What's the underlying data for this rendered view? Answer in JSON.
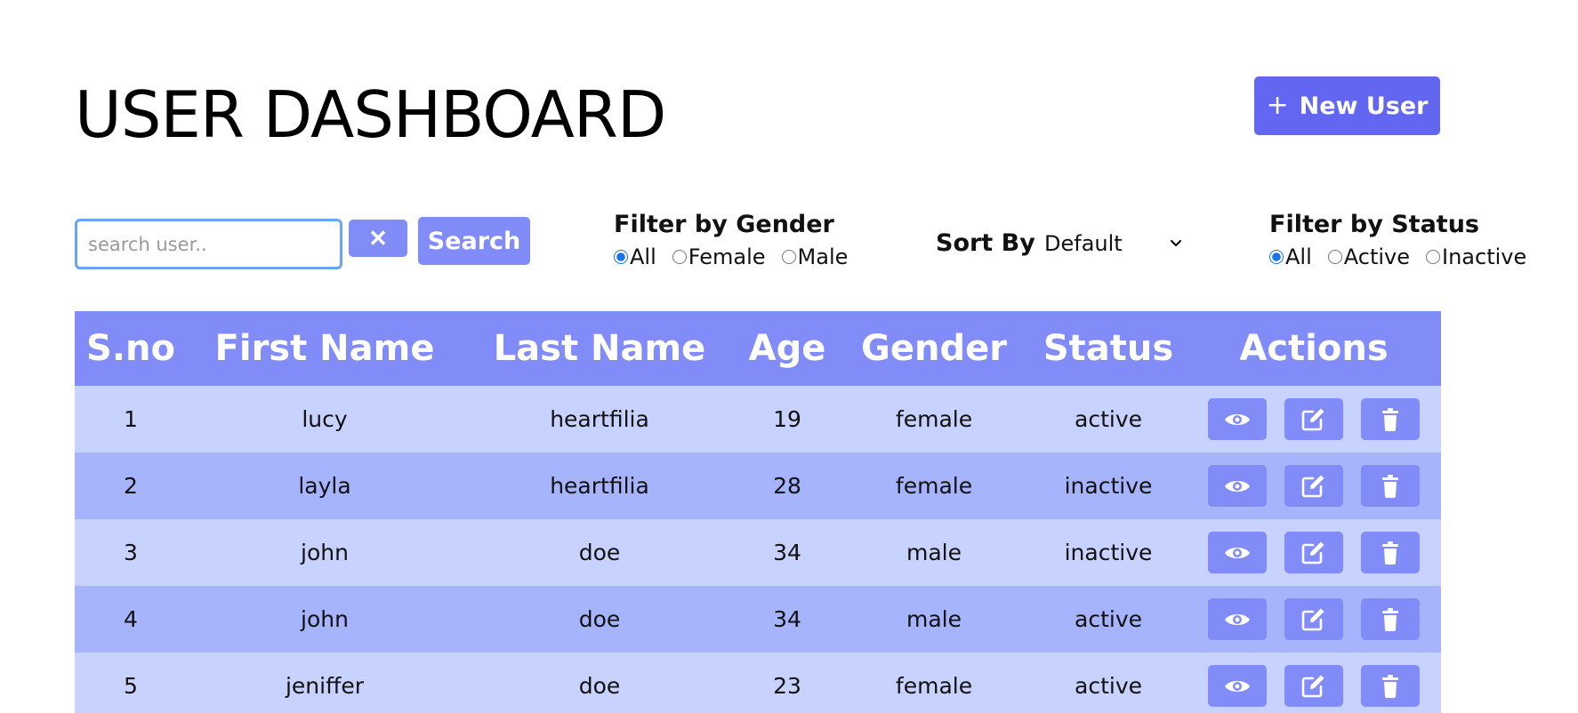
{
  "header": {
    "title": "USER DASHBOARD",
    "new_user_label": "New User",
    "new_user_icon": "plus-icon"
  },
  "toolbar": {
    "search_placeholder": "search user..",
    "search_value": "",
    "clear_label": "✕",
    "search_label": "Search",
    "gender_filter": {
      "title": "Filter by Gender",
      "options": [
        "All",
        "Female",
        "Male"
      ],
      "selected": "All"
    },
    "sort": {
      "label": "Sort By",
      "value": "Default"
    },
    "status_filter": {
      "title": "Filter by Status",
      "options": [
        "All",
        "Active",
        "Inactive"
      ],
      "selected": "All"
    }
  },
  "table": {
    "columns": [
      "S.no",
      "First Name",
      "Last Name",
      "Age",
      "Gender",
      "Status",
      "Actions"
    ],
    "rows": [
      {
        "sno": "1",
        "first": "lucy",
        "last": "heartfilia",
        "age": "19",
        "gender": "female",
        "status": "active"
      },
      {
        "sno": "2",
        "first": "layla",
        "last": "heartfilia",
        "age": "28",
        "gender": "female",
        "status": "inactive"
      },
      {
        "sno": "3",
        "first": "john",
        "last": "doe",
        "age": "34",
        "gender": "male",
        "status": "inactive"
      },
      {
        "sno": "4",
        "first": "john",
        "last": "doe",
        "age": "34",
        "gender": "male",
        "status": "active"
      },
      {
        "sno": "5",
        "first": "jeniffer",
        "last": "doe",
        "age": "23",
        "gender": "female",
        "status": "active"
      }
    ],
    "action_icons": [
      "eye-icon",
      "edit-icon",
      "trash-icon"
    ]
  },
  "colors": {
    "primary": "#6366f1",
    "accent": "#818cf8",
    "row_light": "#c7d2fe",
    "row_dark": "#a5b4fc"
  }
}
